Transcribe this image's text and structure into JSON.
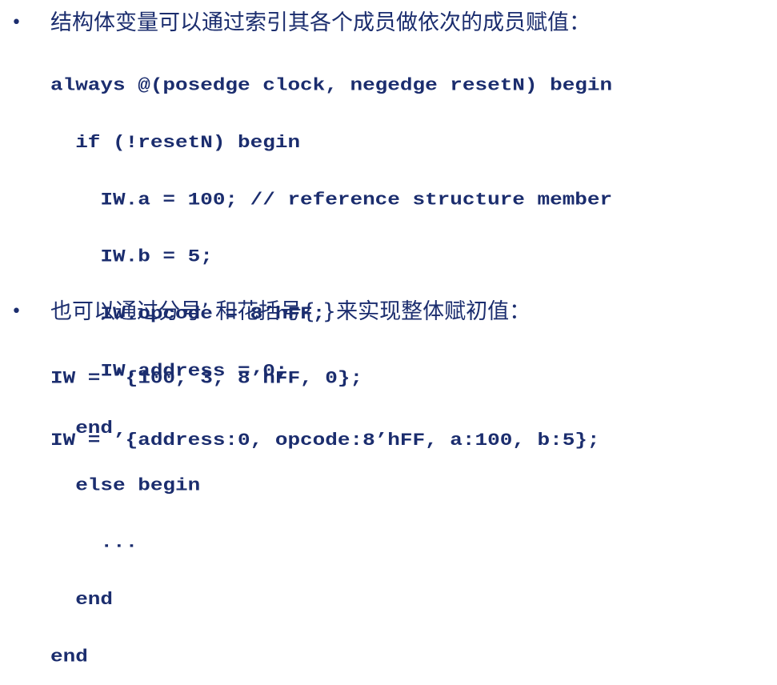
{
  "section1": {
    "bullet": "•",
    "heading": "结构体变量可以通过索引其各个成员做依次的成员赋值：",
    "code": [
      "always @(posedge clock, negedge resetN) begin",
      "  if (!resetN) begin",
      "    IW.a = 100; // reference structure member",
      "    IW.b = 5;",
      "    IW.opcode = 8’hFF;",
      "    IW.address = 0;",
      "  end",
      "  else begin",
      "    ...",
      "  end",
      "end"
    ]
  },
  "section2": {
    "bullet": "•",
    "heading": "也可以通过分号’ 和花括号{ }来实现整体赋初值：",
    "code": [
      "IW = ’{100, 3, 8’hFF, 0};",
      "IW = ’{address:0, opcode:8’hFF, a:100, b:5};"
    ]
  }
}
